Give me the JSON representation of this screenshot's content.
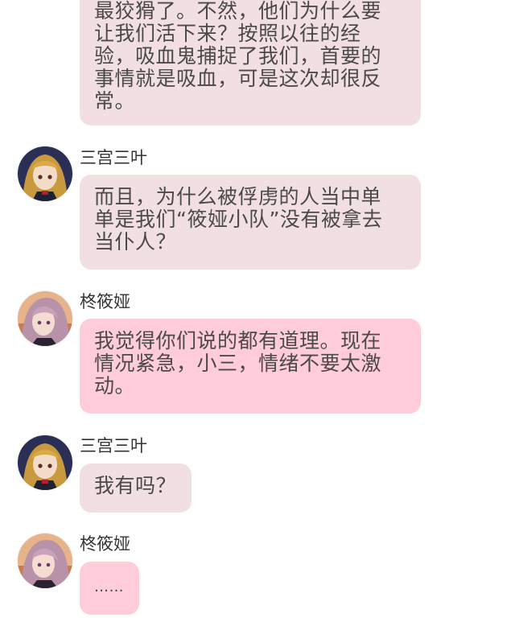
{
  "colors": {
    "bubble_mitsuba": "#f2dfe1",
    "bubble_shinoa": "#ffccd9",
    "background": "#ffffff"
  },
  "messages": [
    {
      "sender": "",
      "text": "最狡猾了。不然，他们为什么要\n让我们活下来？按照以往的经\n验，吸血鬼捕捉了我们，首要的\n事情就是吸血，可是这次却很反\n常。"
    },
    {
      "sender": "三宫三叶",
      "avatar_icon": "mitsuba-avatar-icon",
      "text": "而且，为什么被俘虏的人当中单\n单是我们“筱娅小队”没有被拿去\n当仆人？"
    },
    {
      "sender": "柊筱娅",
      "avatar_icon": "shinoa-avatar-icon",
      "text": "我觉得你们说的都有道理。现在\n情况紧急，小三，情绪不要太激\n动。"
    },
    {
      "sender": "三宫三叶",
      "avatar_icon": "mitsuba-avatar-icon",
      "text": "我有吗？"
    },
    {
      "sender": "柊筱娅",
      "avatar_icon": "shinoa-avatar-icon",
      "text": "……"
    }
  ]
}
